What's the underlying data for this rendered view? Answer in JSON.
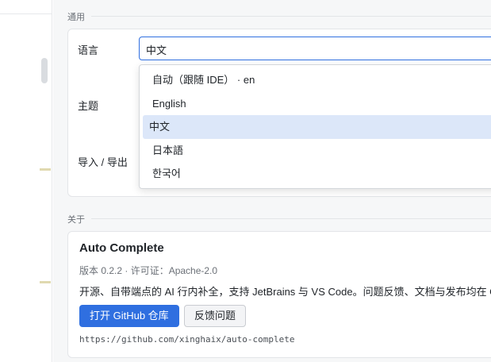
{
  "general": {
    "section_title": "通用",
    "language_label": "语言",
    "theme_label": "主题",
    "import_export_label": "导入 / 导出",
    "language_value": "中文",
    "language_options": [
      "自动（跟随 IDE） · en",
      "English",
      "中文",
      "日本語",
      "한국어"
    ],
    "selected_index": 2
  },
  "about": {
    "section_title": "关于",
    "title": "Auto Complete",
    "meta": "版本 0.2.2 · 许可证：Apache-2.0",
    "description": "开源、自带端点的 AI 行内补全，支持 JetBrains 与 VS Code。问题反馈、文档与发布均在 Git",
    "open_github_label": "打开 GitHub 仓库",
    "feedback_label": "反馈问题",
    "repo_url": "https://github.com/xinghaix/auto-complete"
  },
  "colors": {
    "accent": "#2f6fe0",
    "selected_bg": "#dce7f9"
  }
}
